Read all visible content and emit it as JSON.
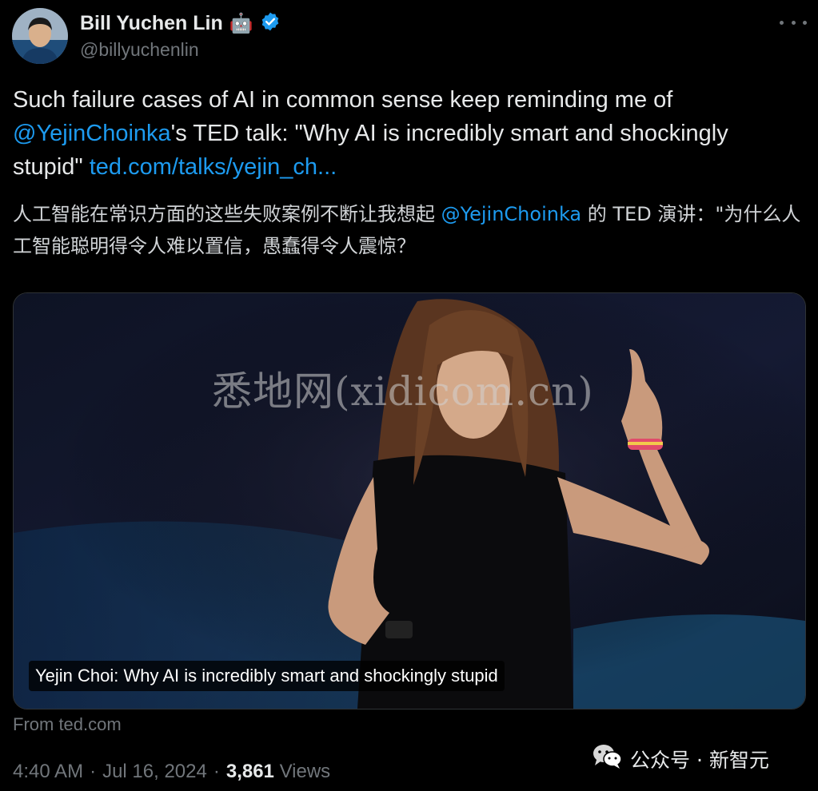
{
  "author": {
    "name": "Bill Yuchen Lin",
    "name_emoji": "🤖",
    "handle": "@billyuchenlin",
    "verified": true
  },
  "tweet": {
    "text_part1": "Such failure cases of AI in common sense keep reminding me of ",
    "mention": "@YejinChoinka",
    "text_part2": "'s TED talk: \"Why AI is incredibly smart and shockingly stupid\" ",
    "link": "ted.com/talks/yejin_ch..."
  },
  "translation": {
    "part1": "人工智能在常识方面的这些失败案例不断让我想起 ",
    "mention": "@YejinChoinka",
    "part2": " 的 TED 演讲：\"为什么人工智能聪明得令人难以置信，愚蠢得令人震惊？"
  },
  "card": {
    "caption": "Yejin Choi: Why AI is incredibly smart and shockingly stupid",
    "source": "From ted.com"
  },
  "watermark": "悉地网(xidicom.cn)",
  "meta": {
    "time": "4:40 AM",
    "sep1": "·",
    "date": "Jul 16, 2024",
    "sep2": "·",
    "views_count": "3,861",
    "views_label": "Views"
  },
  "wechat": {
    "label": "公众号 · 新智元"
  },
  "colors": {
    "accent": "#1d9bf0",
    "background": "#000000",
    "text": "#e7e9ea",
    "muted": "#71767b"
  }
}
